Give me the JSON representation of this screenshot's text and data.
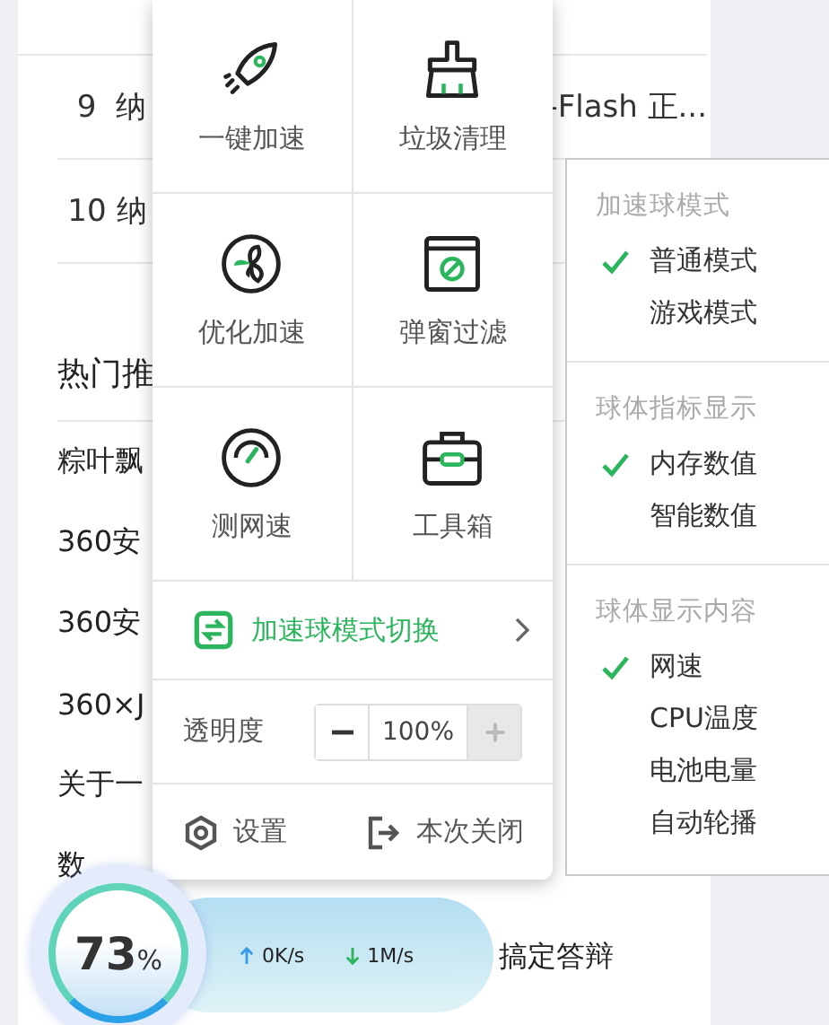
{
  "background_list": {
    "rows": [
      {
        "number": "9",
        "left_text": "纳",
        "right_text": "-Flash 正..."
      },
      {
        "number": "10",
        "left_text": "纳",
        "right_text": ""
      }
    ]
  },
  "hot_section": {
    "title": "热门推",
    "rows": [
      {
        "kind": "lead",
        "text": "粽叶飘"
      },
      {
        "kind": "lead",
        "text": "360安"
      },
      {
        "kind": "lead",
        "text": "360安"
      },
      {
        "kind": "lead",
        "text": "360×J"
      },
      {
        "kind": "lead",
        "text": "关于一"
      },
      {
        "kind": "lead",
        "text": "数"
      },
      {
        "kind": "trail",
        "text": "搞定答辩"
      }
    ]
  },
  "quick_panel": {
    "tiles": [
      {
        "kind": "rocket",
        "label": "一键加速"
      },
      {
        "kind": "broom",
        "label": "垃圾清理"
      },
      {
        "kind": "fan",
        "label": "优化加速"
      },
      {
        "kind": "popup",
        "label": "弹窗过滤"
      },
      {
        "kind": "gauge",
        "label": "测网速"
      },
      {
        "kind": "toolbox",
        "label": "工具箱"
      }
    ],
    "mode_switch": {
      "label": "加速球模式切换",
      "expanded": true
    },
    "transparency": {
      "label": "透明度",
      "value": "100%",
      "minus_disabled": false,
      "plus_disabled": true
    },
    "footer": [
      {
        "kind": "settings",
        "label": "设置"
      },
      {
        "kind": "exit",
        "label": "本次关闭"
      }
    ]
  },
  "mode_menu": {
    "sections": [
      {
        "title": "加速球模式",
        "items": [
          {
            "label": "普通模式",
            "checked": true
          },
          {
            "label": "游戏模式",
            "checked": false
          }
        ]
      },
      {
        "title": "球体指标显示",
        "items": [
          {
            "label": "内存数值",
            "checked": true
          },
          {
            "label": "智能数值",
            "checked": false
          }
        ]
      },
      {
        "title": "球体显示内容",
        "items": [
          {
            "label": "网速",
            "checked": true
          },
          {
            "label": "CPU温度",
            "checked": false
          },
          {
            "label": "电池电量",
            "checked": false
          },
          {
            "label": "自动轮播",
            "checked": false
          }
        ]
      }
    ]
  },
  "speed_ball": {
    "value": "73",
    "unit": "%",
    "upload": "0K/s",
    "download": "1M/s"
  }
}
